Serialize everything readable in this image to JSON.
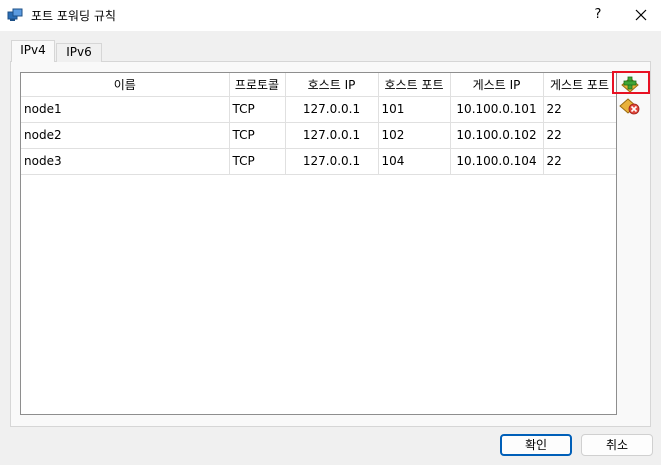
{
  "window": {
    "title": "포트 포워딩 규칙",
    "help_label": "?"
  },
  "tabs": [
    {
      "label": "IPv4"
    },
    {
      "label": "IPv6"
    }
  ],
  "table": {
    "columns": [
      "이름",
      "프로토콜",
      "호스트 IP",
      "호스트 포트",
      "게스트 IP",
      "게스트 포트"
    ],
    "rows": [
      [
        "node1",
        "TCP",
        "127.0.0.1",
        "101",
        "10.100.0.101",
        "22"
      ],
      [
        "node2",
        "TCP",
        "127.0.0.1",
        "102",
        "10.100.0.102",
        "22"
      ],
      [
        "node3",
        "TCP",
        "127.0.0.1",
        "104",
        "10.100.0.104",
        "22"
      ]
    ]
  },
  "buttons": {
    "ok": "확인",
    "cancel": "취소"
  },
  "colors": {
    "highlight": "#e81123",
    "accent": "#005fb8"
  }
}
